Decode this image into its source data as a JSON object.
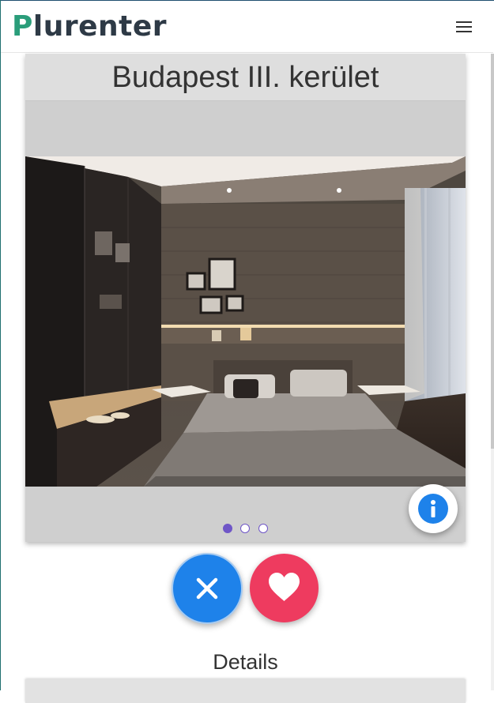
{
  "app": {
    "logo_first_letter": "P",
    "logo_rest": "lurenter",
    "menu_icon": "hamburger-menu-icon",
    "brand_color": "#2a9d7a"
  },
  "listing": {
    "title": "Budapest III. kerület",
    "photo_alt": "Modern bedroom interior with wood paneling and double bed",
    "photo_count": 3,
    "active_photo_index": 0
  },
  "actions": {
    "info_icon": "info-icon",
    "reject_icon": "close-icon",
    "like_icon": "heart-icon",
    "reject_color": "#1e82ea",
    "like_color": "#ee3b5f"
  },
  "details": {
    "heading": "Details"
  }
}
